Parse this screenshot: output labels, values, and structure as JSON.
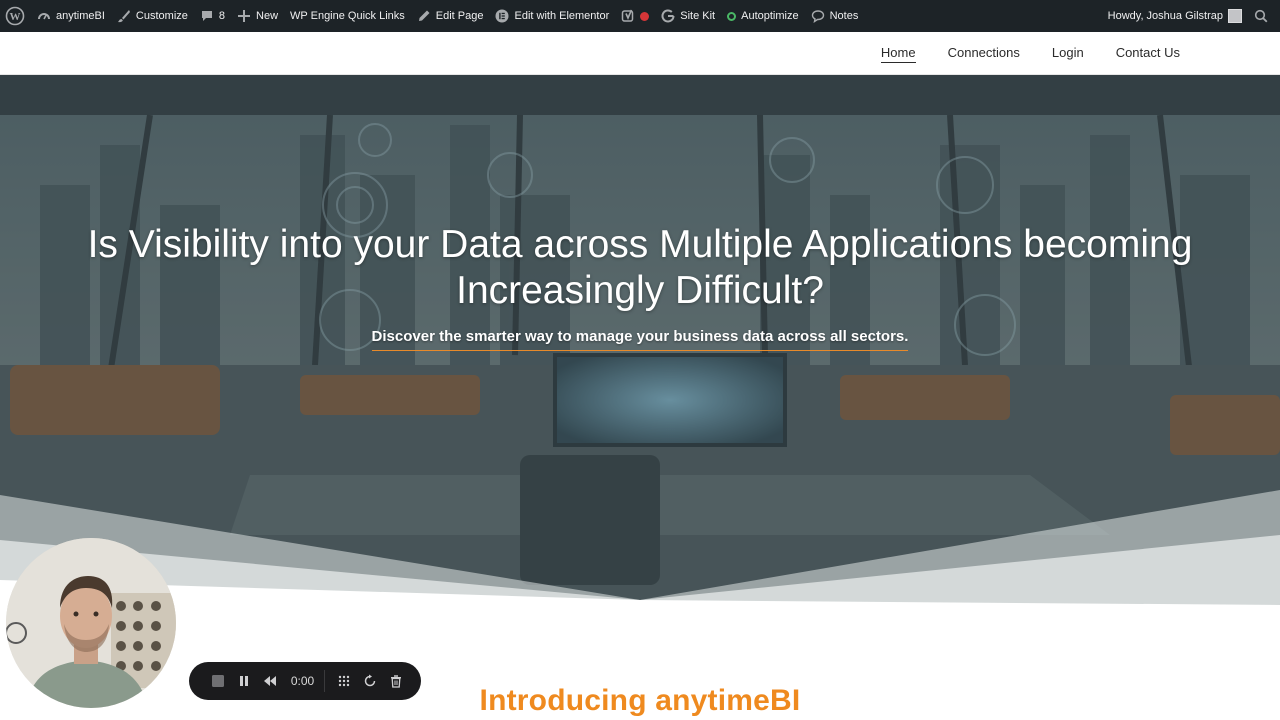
{
  "admin_bar": {
    "site_name": "anytimeBI",
    "customize": "Customize",
    "comments_count": "8",
    "new": "New",
    "wp_engine": "WP Engine Quick Links",
    "edit_page": "Edit Page",
    "elementor": "Edit with Elementor",
    "site_kit": "Site Kit",
    "autoptimize": "Autoptimize",
    "notes": "Notes",
    "greeting": "Howdy, Joshua Gilstrap"
  },
  "nav": {
    "items": [
      {
        "label": "Home",
        "active": true
      },
      {
        "label": "Connections"
      },
      {
        "label": "Login"
      },
      {
        "label": "Contact Us"
      }
    ]
  },
  "hero": {
    "title": "Is Visibility into your Data across Multiple Applications becoming Increasingly Difficult?",
    "subtitle": "Discover the smarter way to manage your business data across all sectors."
  },
  "intro": {
    "heading": "Introducing anytimeBI"
  },
  "recorder": {
    "time": "0:00"
  },
  "colors": {
    "admin_bar": "#1d2327",
    "accent_orange": "#ef8a1f",
    "hero_overlay": "#4f6166"
  }
}
